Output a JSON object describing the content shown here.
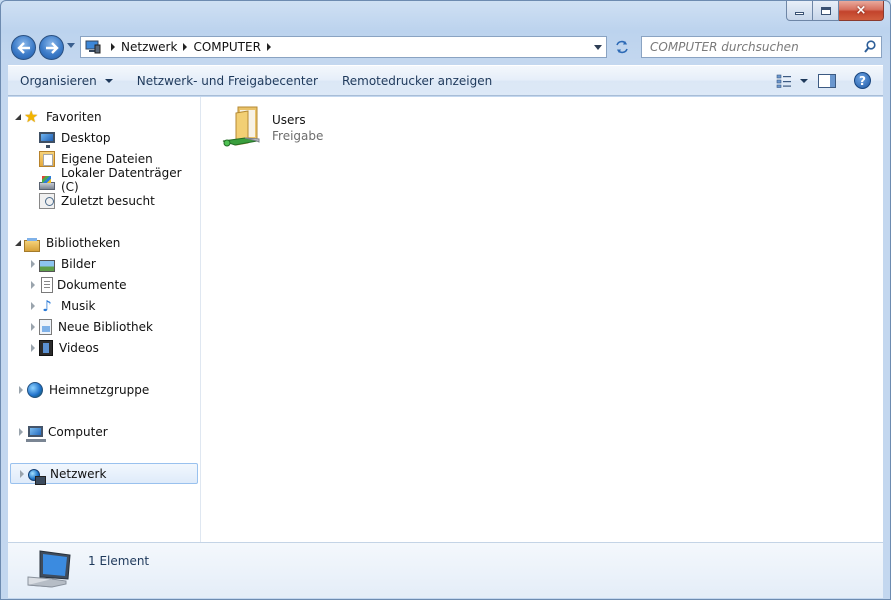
{
  "window": {
    "caption": {
      "minimize": "minimize",
      "maximize": "maximize",
      "close": "×"
    }
  },
  "address": {
    "segments": [
      "Netzwerk",
      "COMPUTER"
    ],
    "search_placeholder": "COMPUTER durchsuchen"
  },
  "toolbar": {
    "organize": "Organisieren",
    "network_center": "Netzwerk- und Freigabecenter",
    "remote_printers": "Remotedrucker anzeigen",
    "help": "?"
  },
  "nav": {
    "favorites": "Favoriten",
    "desktop": "Desktop",
    "my_files": "Eigene Dateien",
    "local_disk": "Lokaler Datenträger (C)",
    "recent": "Zuletzt besucht",
    "libraries": "Bibliotheken",
    "pictures": "Bilder",
    "documents": "Dokumente",
    "music": "Musik",
    "new_library": "Neue Bibliothek",
    "videos": "Videos",
    "homegroup": "Heimnetzgruppe",
    "computer": "Computer",
    "network": "Netzwerk"
  },
  "files": [
    {
      "name": "Users",
      "subtitle": "Freigabe"
    }
  ],
  "details": {
    "count_text": "1 Element"
  },
  "icons": {
    "back": "back-arrow-icon",
    "forward": "forward-arrow-icon",
    "refresh": "refresh-icon",
    "search": "search-icon",
    "shared_folder": "shared-folder-icon",
    "computer": "computer-icon"
  },
  "colors": {
    "link_text": "#1e395b",
    "selection_border": "#99c1ee",
    "secondary_text": "#6d6d6d"
  }
}
